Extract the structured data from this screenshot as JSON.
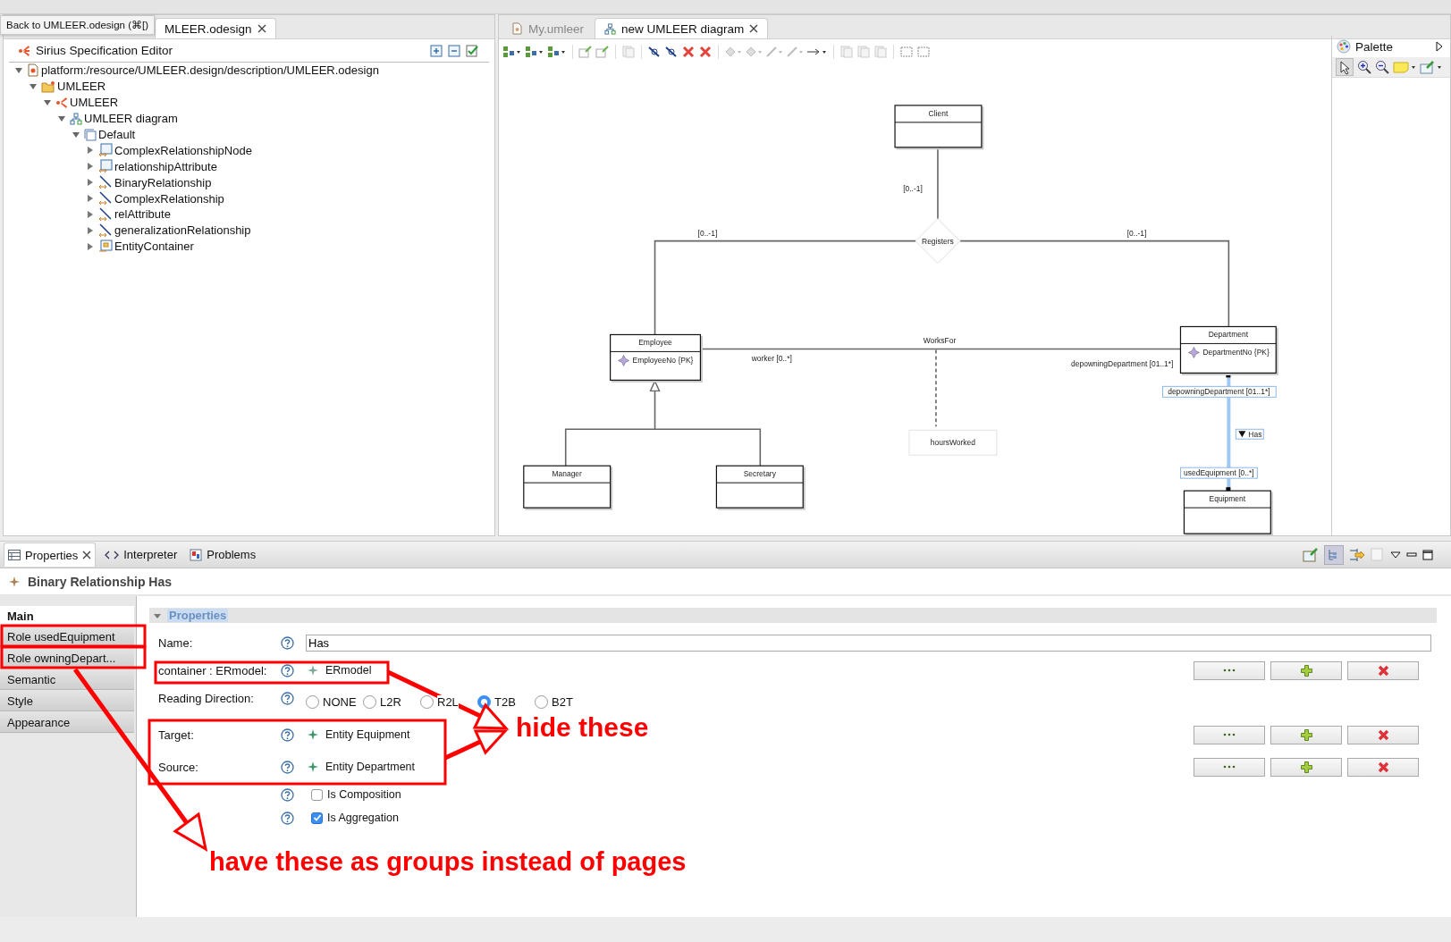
{
  "tooltip": "Back to UMLEER.odesign (⌘[)",
  "left_editor": {
    "tabs": [
      {
        "label": "MLEER.odesign",
        "selected": true
      }
    ],
    "title": "Sirius Specification Editor",
    "tree": [
      {
        "label": "platform:/resource/UMLEER.design/description/UMLEER.odesign",
        "kind": "resource",
        "expanded": true,
        "children": [
          {
            "label": "UMLEER",
            "kind": "folder",
            "expanded": true,
            "children": [
              {
                "label": "UMLEER",
                "kind": "viewpoint",
                "expanded": true,
                "children": [
                  {
                    "label": "UMLEER diagram",
                    "kind": "diagram",
                    "expanded": true,
                    "children": [
                      {
                        "label": "Default",
                        "kind": "layer",
                        "expanded": true,
                        "children": [
                          {
                            "label": "ComplexRelationshipNode",
                            "kind": "node",
                            "expanded": false
                          },
                          {
                            "label": "relationshipAttribute",
                            "kind": "node",
                            "expanded": false
                          },
                          {
                            "label": "BinaryRelationship",
                            "kind": "edge",
                            "expanded": false
                          },
                          {
                            "label": "ComplexRelationship",
                            "kind": "edge",
                            "expanded": false
                          },
                          {
                            "label": "relAttribute",
                            "kind": "edge",
                            "expanded": false
                          },
                          {
                            "label": "generalizationRelationship",
                            "kind": "edge",
                            "expanded": false
                          },
                          {
                            "label": "EntityContainer",
                            "kind": "container",
                            "expanded": false
                          }
                        ]
                      }
                    ]
                  }
                ]
              }
            ]
          }
        ]
      }
    ]
  },
  "diagram_editor": {
    "tabs": [
      {
        "label": "My.umleer",
        "selected": false
      },
      {
        "label": "new UMLEER diagram",
        "selected": true
      }
    ],
    "palette": {
      "title": "Palette"
    },
    "diagram": {
      "entities": [
        {
          "name": "Client"
        },
        {
          "name": "Employee",
          "attributes": [
            "EmployeeNo {PK}"
          ]
        },
        {
          "name": "Department",
          "attributes": [
            "DepartmentNo {PK}"
          ]
        },
        {
          "name": "Manager"
        },
        {
          "name": "Secretary"
        },
        {
          "name": "Equipment"
        }
      ],
      "relationship": {
        "name": "Registers",
        "roles": [
          "[0..-1]",
          "[0..-1]",
          "[0..-1]"
        ]
      },
      "works_for": {
        "name": "WorksFor",
        "source_role": "worker [0..*]",
        "target_role": "depowningDepartment [01..1*]",
        "attribute": "hoursWorked"
      },
      "has": {
        "name": "Has",
        "source_role": "depowningDepartment [01..1*]",
        "target_role": "usedEquipment [0..*]",
        "selected": true
      }
    }
  },
  "properties_view": {
    "tabs": [
      {
        "label": "Properties",
        "kind": "properties",
        "selected": true
      },
      {
        "label": "Interpreter",
        "kind": "interpreter",
        "selected": false
      },
      {
        "label": "Problems",
        "kind": "problems",
        "selected": false
      }
    ],
    "title": "Binary Relationship Has",
    "pages": [
      {
        "label": "Main",
        "selected": true
      },
      {
        "label": "Role usedEquipment",
        "selected": false
      },
      {
        "label": "Role owningDepart...",
        "selected": false
      },
      {
        "label": "Semantic",
        "selected": false
      },
      {
        "label": "Style",
        "selected": false
      },
      {
        "label": "Appearance",
        "selected": false
      }
    ],
    "section": {
      "title": "Properties",
      "expanded": true
    },
    "fields": [
      {
        "kind": "text",
        "label": "Name:",
        "value": "Has"
      },
      {
        "kind": "reference",
        "label": "container : ERmodel:",
        "value": "ERmodel"
      },
      {
        "kind": "radio",
        "label": "Reading Direction:",
        "options": [
          {
            "label": "NONE",
            "selected": false
          },
          {
            "label": "L2R",
            "selected": false
          },
          {
            "label": "R2L",
            "selected": false
          },
          {
            "label": "T2B",
            "selected": true
          },
          {
            "label": "B2T",
            "selected": false
          }
        ]
      },
      {
        "kind": "reference",
        "label": "Target:",
        "value": "Entity Equipment"
      },
      {
        "kind": "reference",
        "label": "Source:",
        "value": "Entity Department"
      },
      {
        "kind": "checkbox",
        "label": "Is Composition",
        "checked": false
      },
      {
        "kind": "checkbox",
        "label": "Is Aggregation",
        "checked": true
      }
    ]
  },
  "annotations": [
    {
      "text": "hide these"
    },
    {
      "text": "have these as groups instead of pages"
    }
  ]
}
